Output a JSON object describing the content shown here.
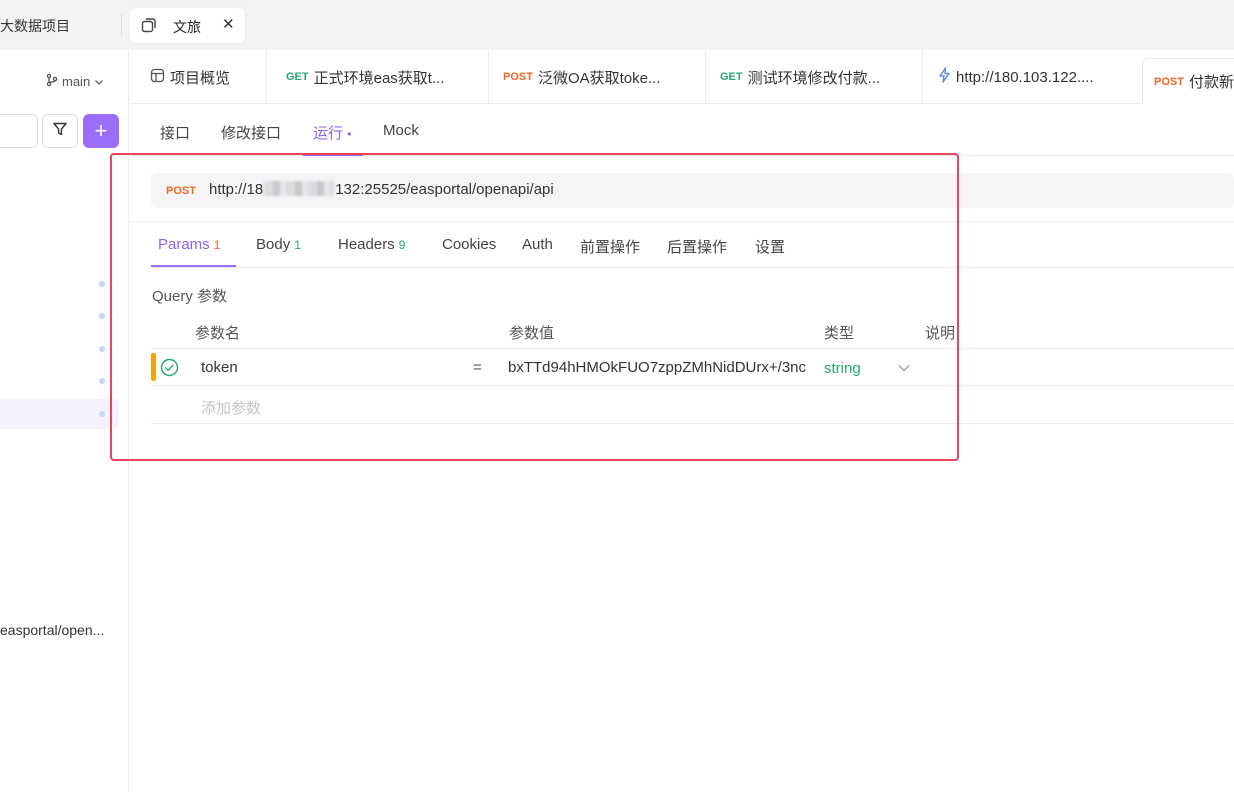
{
  "workspace": {
    "project_name": "大数据项目"
  },
  "window_tab": {
    "label": "文旅",
    "close": "✕"
  },
  "sidebar": {
    "branch": "main",
    "add_label": "+",
    "selected_item_url": "easportal/open..."
  },
  "api_tabs": [
    {
      "label": "项目概览",
      "method": ""
    },
    {
      "label": "正式环境eas获取t...",
      "method": "GET"
    },
    {
      "label": "泛微OA获取toke...",
      "method": "POST"
    },
    {
      "label": "测试环境修改付款...",
      "method": "GET"
    },
    {
      "label": "http://180.103.122....",
      "method": ""
    },
    {
      "label": "付款新",
      "method": "POST"
    }
  ],
  "sub_tabs": [
    "接口",
    "修改接口",
    "运行",
    "Mock"
  ],
  "sub_tab_dot": "•",
  "request": {
    "method": "POST",
    "url_prefix": "http://18",
    "url_suffix": "132:25525/easportal/openapi/api"
  },
  "param_tabs": [
    {
      "label": "Params",
      "count": "1"
    },
    {
      "label": "Body",
      "count": "1"
    },
    {
      "label": "Headers",
      "count": "9"
    },
    {
      "label": "Cookies",
      "count": ""
    },
    {
      "label": "Auth",
      "count": ""
    },
    {
      "label": "前置操作",
      "count": ""
    },
    {
      "label": "后置操作",
      "count": ""
    },
    {
      "label": "设置",
      "count": ""
    }
  ],
  "query": {
    "section_label": "Query 参数",
    "headers": {
      "name": "参数名",
      "value": "参数值",
      "type": "类型",
      "desc": "说明"
    },
    "rows": [
      {
        "name": "token",
        "eq": "=",
        "value": "bxTTd94hHMOkFUO7zppZMhNidDUrx+/3nc",
        "type": "string"
      }
    ],
    "add_placeholder": "添加参数"
  },
  "colors": {
    "accent": "#9a6ef7",
    "get": "#29a76f",
    "post": "#f26522",
    "highlight_border": "#e8445a"
  }
}
